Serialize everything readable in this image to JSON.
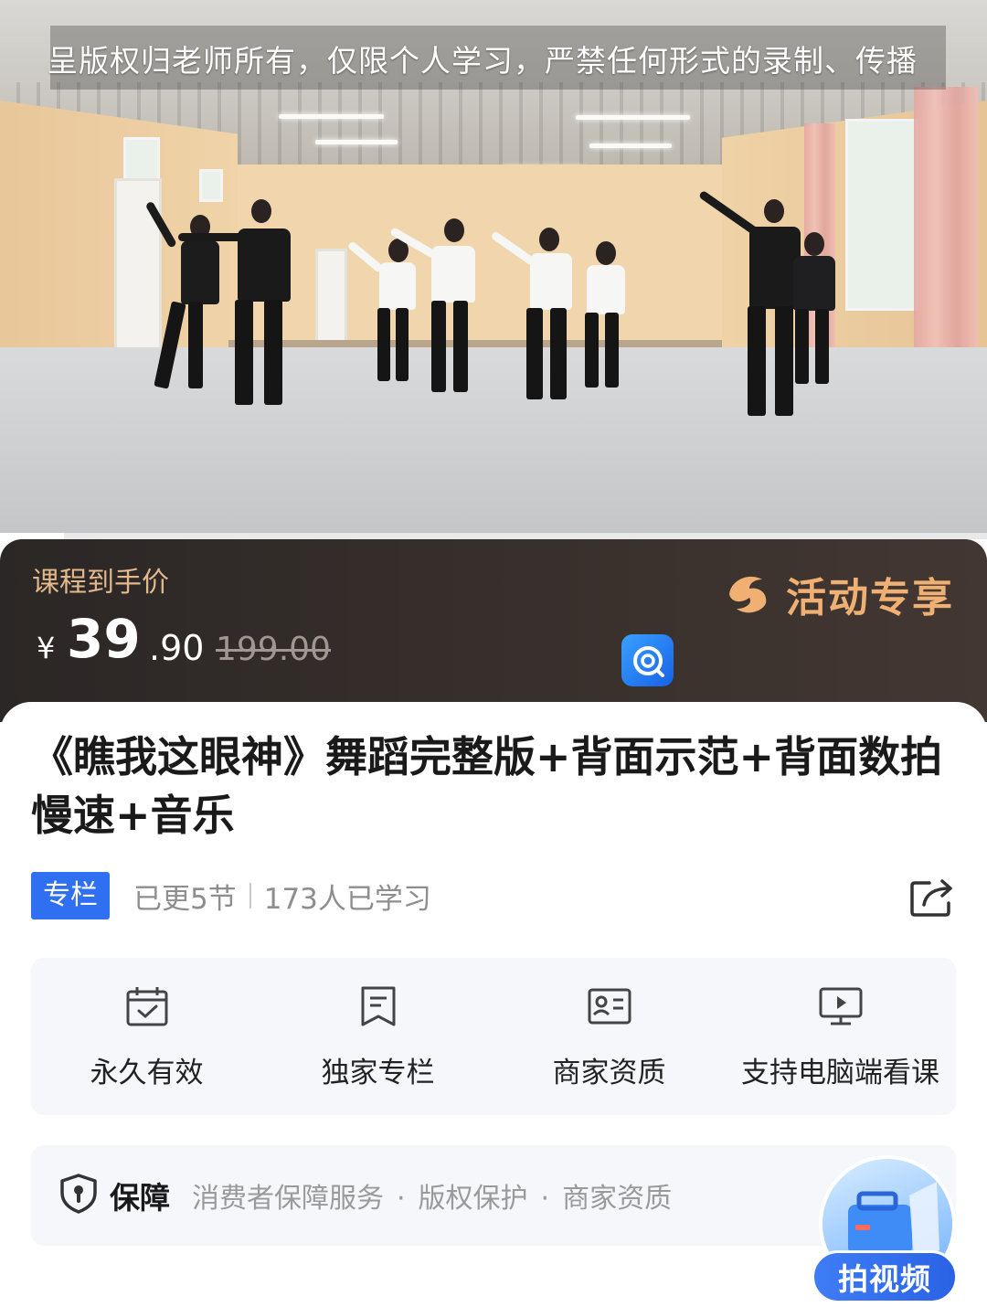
{
  "video": {
    "watermark_text": "呈版权归老师所有，仅限个人学习，严禁任何形式的录制、传播",
    "progress": 0.065
  },
  "price": {
    "label": "课程到手价",
    "currency": "¥",
    "integer": "39",
    "decimal": ".90",
    "original": "199.00",
    "promo_text": "活动专享",
    "accent_color": "#e2b98b"
  },
  "course": {
    "title": "《瞧我这眼神》舞蹈完整版+背面示范+背面数拍慢速+音乐",
    "tag": "专栏",
    "updated": "已更5节",
    "learners": "173人已学习"
  },
  "features": [
    {
      "icon": "calendar-check-icon",
      "label": "永久有效"
    },
    {
      "icon": "bookmark-doc-icon",
      "label": "独家专栏"
    },
    {
      "icon": "id-card-icon",
      "label": "商家资质"
    },
    {
      "icon": "monitor-play-icon",
      "label": "支持电脑端看课"
    }
  ],
  "guarantee": {
    "title": "保障",
    "items": [
      "消费者保障服务",
      "版权保护",
      "商家资质"
    ],
    "separator": "·"
  },
  "float_button": {
    "label": "拍视频"
  },
  "colors": {
    "brand_blue": "#2f6ff2",
    "price_panel_dark": "#2b2726",
    "promo_orange": "#f0b073"
  }
}
